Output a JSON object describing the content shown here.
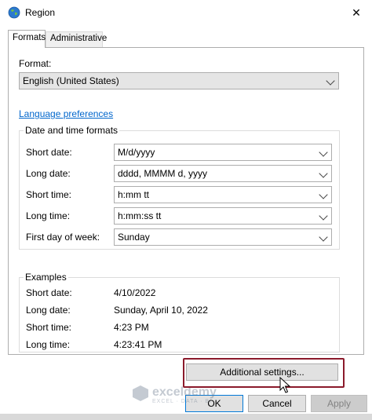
{
  "window": {
    "title": "Region",
    "close_glyph": "✕"
  },
  "tabs": [
    {
      "label": "Formats",
      "active": true
    },
    {
      "label": "Administrative",
      "active": false
    }
  ],
  "format": {
    "label": "Format:",
    "value": "English (United States)"
  },
  "language_link": "Language preferences",
  "date_time": {
    "title": "Date and time formats",
    "rows": [
      {
        "label": "Short date:",
        "value": "M/d/yyyy"
      },
      {
        "label": "Long date:",
        "value": "dddd, MMMM d, yyyy"
      },
      {
        "label": "Short time:",
        "value": "h:mm tt"
      },
      {
        "label": "Long time:",
        "value": "h:mm:ss tt"
      },
      {
        "label": "First day of week:",
        "value": "Sunday"
      }
    ]
  },
  "examples": {
    "title": "Examples",
    "rows": [
      {
        "label": "Short date:",
        "value": "4/10/2022"
      },
      {
        "label": "Long date:",
        "value": "Sunday, April 10, 2022"
      },
      {
        "label": "Short time:",
        "value": "4:23 PM"
      },
      {
        "label": "Long time:",
        "value": "4:23:41 PM"
      }
    ]
  },
  "buttons": {
    "additional": "Additional settings...",
    "ok": "OK",
    "cancel": "Cancel",
    "apply": "Apply"
  },
  "watermark": {
    "brand": "exceldemy",
    "tagline": "EXCEL · DATA · BI"
  },
  "colors": {
    "link": "#0066cc",
    "highlight": "#8b1a2b",
    "focus": "#0078d7"
  }
}
